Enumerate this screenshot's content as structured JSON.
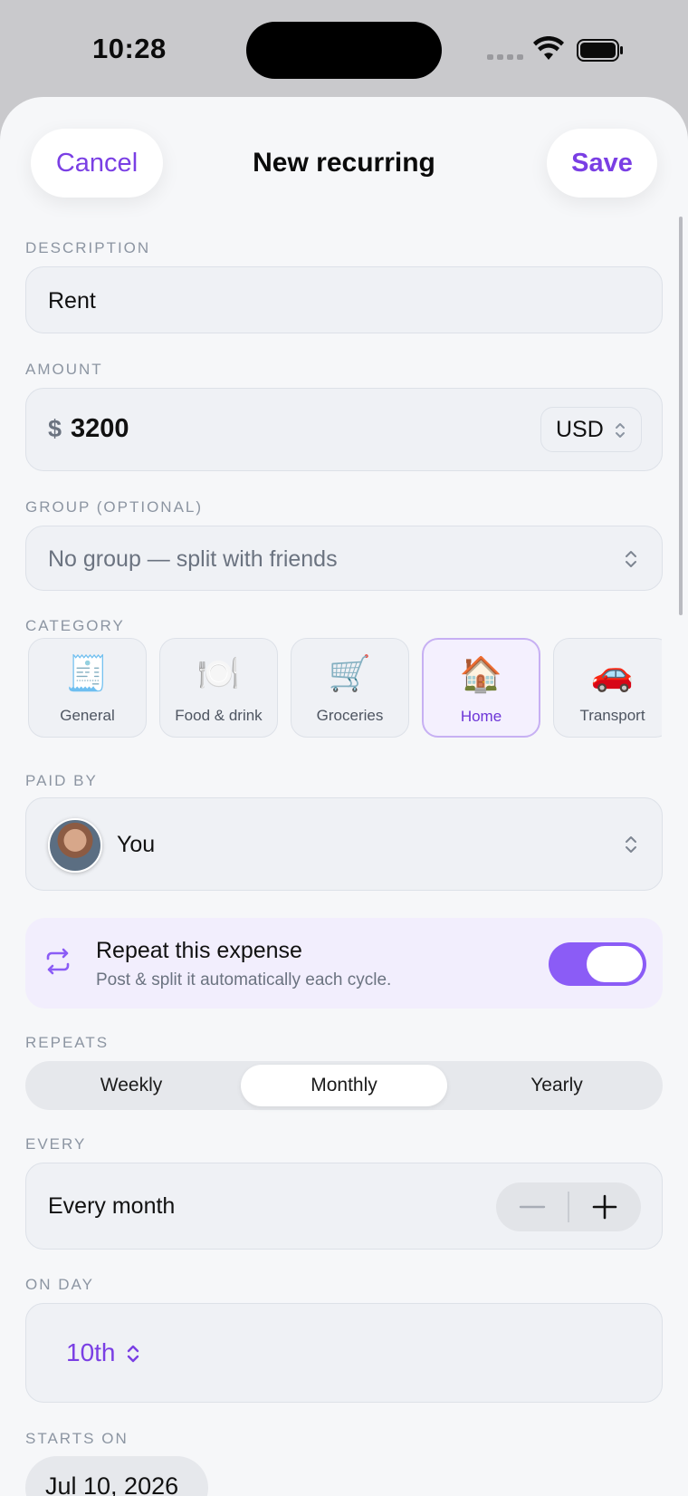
{
  "status_bar": {
    "time": "10:28"
  },
  "nav": {
    "cancel_label": "Cancel",
    "title": "New recurring",
    "save_label": "Save"
  },
  "description": {
    "label": "DESCRIPTION",
    "value": "Rent"
  },
  "amount": {
    "label": "AMOUNT",
    "symbol": "$",
    "value": "3200",
    "currency": "USD"
  },
  "group": {
    "label": "GROUP (OPTIONAL)",
    "value": "No group — split with friends"
  },
  "category": {
    "label": "CATEGORY",
    "items": [
      {
        "emoji": "🧾",
        "name": "General"
      },
      {
        "emoji": "🍽️",
        "name": "Food & drink"
      },
      {
        "emoji": "🛒",
        "name": "Groceries"
      },
      {
        "emoji": "🏠",
        "name": "Home"
      },
      {
        "emoji": "🚗",
        "name": "Transport"
      }
    ],
    "selected": "Home"
  },
  "paid_by": {
    "label": "PAID BY",
    "value": "You"
  },
  "repeat": {
    "title": "Repeat this expense",
    "subtitle": "Post & split it automatically each cycle.",
    "enabled": true
  },
  "repeats": {
    "label": "REPEATS",
    "options": [
      "Weekly",
      "Monthly",
      "Yearly"
    ],
    "selected": "Monthly"
  },
  "every": {
    "label": "EVERY",
    "value": "Every month"
  },
  "on_day": {
    "label": "ON DAY",
    "value": "10th"
  },
  "starts_on": {
    "label": "STARTS ON",
    "value": "Jul 10, 2026"
  },
  "colors": {
    "accent": "#7a3fe4",
    "toggle": "#8b5cf6",
    "selected_bg": "#f4f0fe"
  }
}
